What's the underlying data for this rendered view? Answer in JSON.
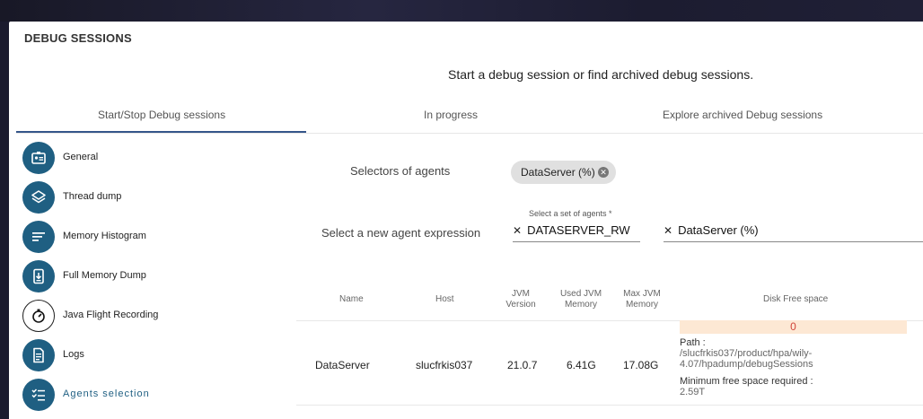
{
  "panel": {
    "title": "DEBUG SESSIONS"
  },
  "subtitle": "Start a debug session or find archived debug sessions.",
  "tabs": [
    {
      "label": "Start/Stop Debug sessions",
      "active": true
    },
    {
      "label": "In progress",
      "active": false
    },
    {
      "label": "Explore archived Debug sessions",
      "active": false
    }
  ],
  "sidebar": {
    "items": [
      {
        "label": "General",
        "icon": "id-card-icon"
      },
      {
        "label": "Thread dump",
        "icon": "layers-icon"
      },
      {
        "label": "Memory Histogram",
        "icon": "lines-icon"
      },
      {
        "label": "Full Memory Dump",
        "icon": "download-file-icon"
      },
      {
        "label": "Java Flight Recording",
        "icon": "stopwatch-icon"
      },
      {
        "label": "Logs",
        "icon": "document-icon"
      },
      {
        "label": "Agents selection",
        "icon": "checklist-icon",
        "active": true
      }
    ]
  },
  "selectors": {
    "label": "Selectors of agents",
    "chip": "DataServer (%)"
  },
  "new_expression": {
    "label": "Select a new agent expression",
    "field_hint": "Select a set of agents *",
    "field_value": "DATASERVER_RW",
    "second_value": "DataServer (%)"
  },
  "table": {
    "headers": {
      "name": "Name",
      "host": "Host",
      "jvm": "JVM Version",
      "used": "Used JVM Memory",
      "max": "Max JVM Memory",
      "disk": "Disk Free space"
    },
    "row": {
      "name": "DataServer",
      "host": "slucfrkis037",
      "jvm": "21.0.7",
      "used": "6.41G",
      "max": "17.08G",
      "disk_value": "0",
      "path_label": "Path :",
      "path_value": "/slucfrkis037/product/hpa/wily-4.07/hpadump/debugSessions",
      "min_label": "Minimum free space required :",
      "min_value": "2.59T"
    }
  },
  "colors": {
    "accent": "#1f5f82",
    "tab_underline": "#35568a",
    "disk_warning": "#d0453a"
  }
}
